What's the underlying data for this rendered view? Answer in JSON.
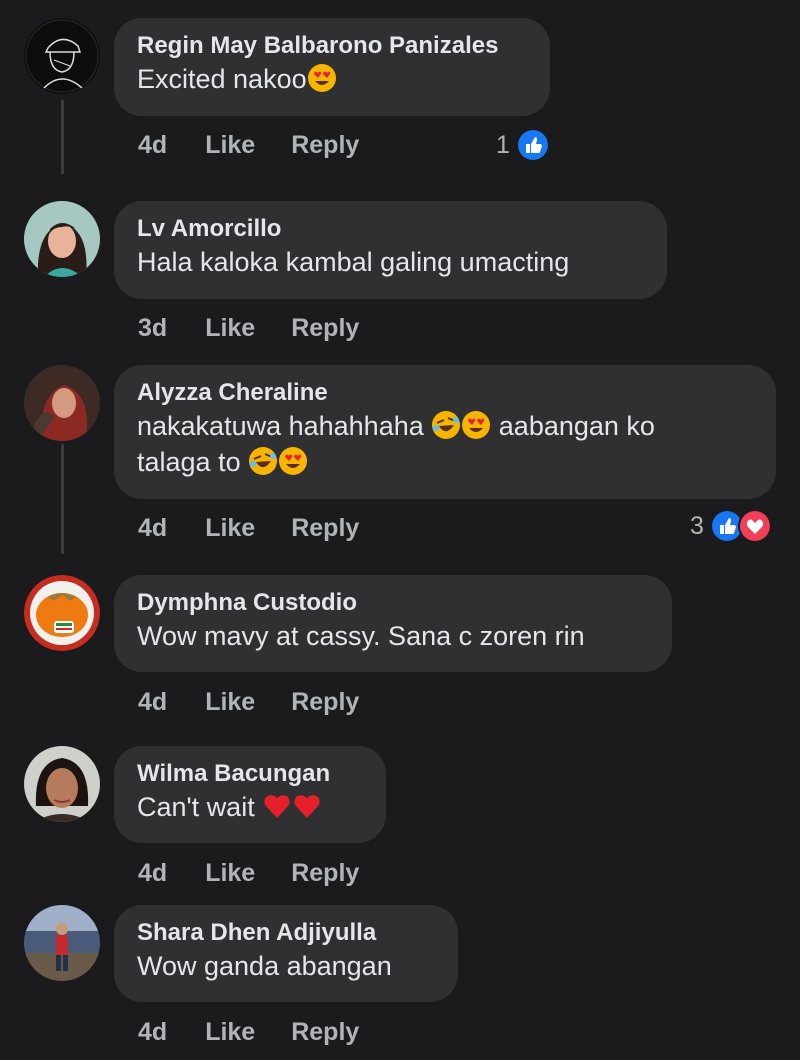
{
  "comments": [
    {
      "author": "Regin May Balbarono Panizales",
      "text": "Excited nakoo",
      "time": "4d",
      "like": "Like",
      "reply": "Reply",
      "reaction_count": "1",
      "reactions": [
        "like"
      ]
    },
    {
      "author": "Lv Amorcillo",
      "text": "Hala kaloka kambal galing umacting",
      "time": "3d",
      "like": "Like",
      "reply": "Reply"
    },
    {
      "author": "Alyzza Cheraline",
      "text_line1": "nakakatuwa hahahhaha",
      "text_line1_after": "aabangan ko",
      "text_line2": "talaga to",
      "time": "4d",
      "like": "Like",
      "reply": "Reply",
      "reaction_count": "3",
      "reactions": [
        "like",
        "love"
      ]
    },
    {
      "author": "Dymphna Custodio",
      "text": "Wow mavy at cassy. Sana c zoren rin",
      "time": "4d",
      "like": "Like",
      "reply": "Reply"
    },
    {
      "author": "Wilma Bacungan",
      "text": "Can't wait",
      "time": "4d",
      "like": "Like",
      "reply": "Reply"
    },
    {
      "author": "Shara Dhen Adjiyulla",
      "text": "Wow ganda abangan",
      "time": "4d",
      "like": "Like",
      "reply": "Reply"
    }
  ],
  "colors": {
    "background": "#1b1b1d",
    "bubble": "#303033",
    "like_blue": "#1877f2",
    "love_red": "#f33e58"
  }
}
